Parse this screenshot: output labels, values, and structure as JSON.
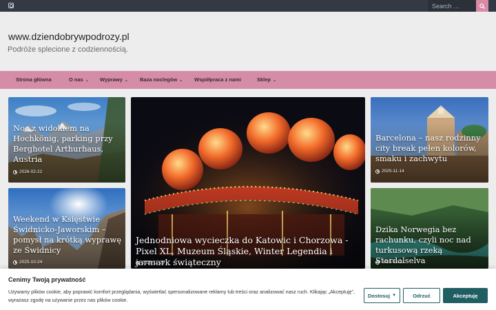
{
  "topbar": {
    "search_placeholder": "Search …",
    "icons": [
      "instagram-icon",
      "search-icon"
    ]
  },
  "site": {
    "title": "www.dziendobrywpodrozy.pl",
    "description": "Podróże splecione z codziennością."
  },
  "nav": {
    "items": [
      {
        "label": "Strona główna",
        "has_dropdown": false
      },
      {
        "label": "O nas",
        "has_dropdown": true
      },
      {
        "label": "Wyprawy",
        "has_dropdown": true
      },
      {
        "label": "Baza noclegów",
        "has_dropdown": true
      },
      {
        "label": "Współpraca z nami",
        "has_dropdown": false
      },
      {
        "label": "Sklep",
        "has_dropdown": true
      }
    ]
  },
  "posts": [
    {
      "title": "Noc z widokiem na Hochkönig, parking przy Berghotel Arthurhaus, Austria",
      "date": "2026-02-22"
    },
    {
      "title": "Weekend w Księstwie Świdnicko-Jaworskim – pomysł na krótką wyprawę ze Świdnicy",
      "date": "2025-10-24"
    },
    {
      "title": "Jednodniowa wycieczka do Katowic i Chorzowa - Pixel XL, Muzeum Śląskie, Winter Legendia i jarmark świąteczny",
      "date": "2025-11-26"
    },
    {
      "title": "Barcelona – nasz rodzinny city break pełen kolorów, smaku i zachwytu",
      "date": "2025-11-14"
    },
    {
      "title": "Dzika Norwegia bez rachunku, czyli noc nad turkusową rzeką Stardalselva",
      "date": "2025-10-23"
    }
  ],
  "cookie": {
    "title": "Cenimy Twoją prywatność",
    "text": "Używamy plików cookie, aby poprawić komfort przeglądania, wyświetlać spersonalizowane reklamy lub treści oraz analizować nasz ruch. Klikając „Akceptuję”, wyrażasz zgodę na używanie przez nas plików cookie.",
    "customize_label": "Dostosuj",
    "reject_label": "Odrzuć",
    "accept_label": "Akceptuję"
  },
  "colors": {
    "topbar": "#343a44",
    "nav": "#d58ca6",
    "accent_button": "#1f5f63",
    "page_bg": "#ededed"
  }
}
